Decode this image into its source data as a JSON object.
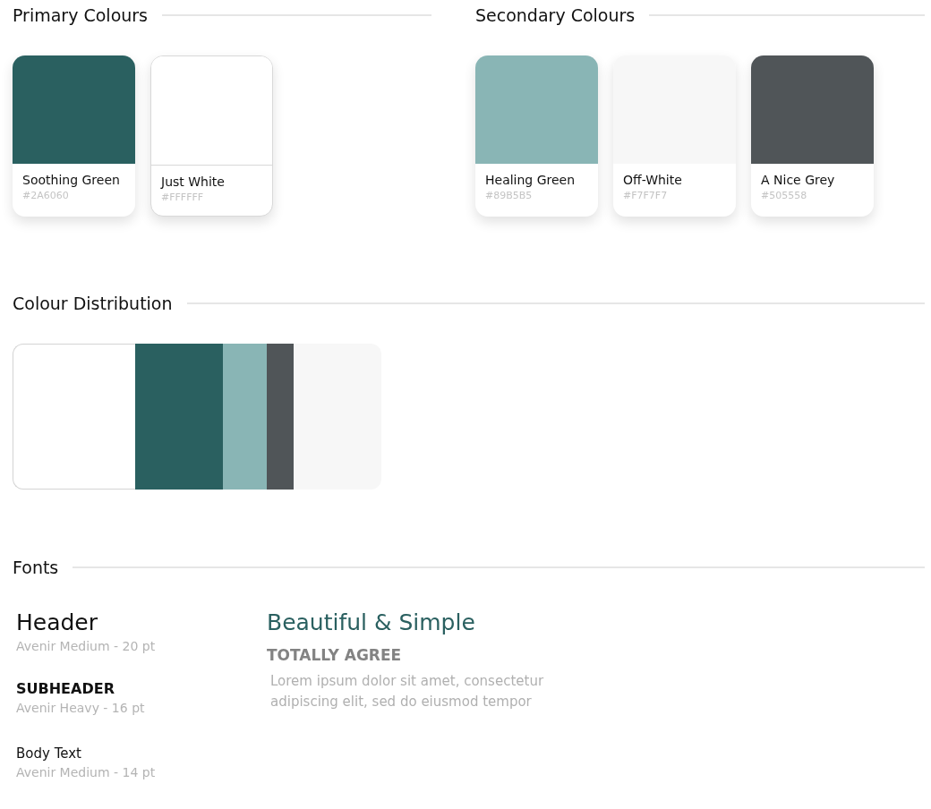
{
  "palettes": [
    {
      "title": "Primary Colours",
      "swatches": [
        {
          "name": "Soothing Green",
          "hex": "#2A6060",
          "color": "#2a6060",
          "bordered": false
        },
        {
          "name": "Just White",
          "hex": "#FFFFFF",
          "color": "#ffffff",
          "bordered": true
        }
      ]
    },
    {
      "title": "Secondary Colours",
      "swatches": [
        {
          "name": "Healing Green",
          "hex": "#89B5B5",
          "color": "#89b5b5",
          "bordered": false
        },
        {
          "name": "Off-White",
          "hex": "#F7F7F7",
          "color": "#f7f7f7",
          "bordered": false
        },
        {
          "name": "A Nice Grey",
          "hex": "#505558",
          "color": "#505558",
          "bordered": false
        }
      ]
    }
  ],
  "distribution": {
    "title": "Colour Distribution",
    "segments": [
      {
        "color": "#ffffff"
      },
      {
        "color": "#2a6060"
      },
      {
        "color": "#89b5b5"
      },
      {
        "color": "#505558"
      },
      {
        "color": "#f7f7f7"
      }
    ]
  },
  "fonts": {
    "title": "Fonts",
    "specimens": [
      {
        "kind": "header",
        "sample": "Header",
        "spec": "Avenir Medium - 20 pt"
      },
      {
        "kind": "subheader",
        "sample": "SUBHEADER",
        "spec": "Avenir Heavy - 16 pt"
      },
      {
        "kind": "body",
        "sample": "Body Text",
        "spec": "Avenir Medium - 14 pt"
      }
    ],
    "preview": {
      "heading": "Beautiful & Simple",
      "subheading": "TOTALLY AGREE",
      "body": "Lorem ipsum dolor sit amet, consectetur adipiscing elit, sed do eiusmod tempor"
    }
  }
}
